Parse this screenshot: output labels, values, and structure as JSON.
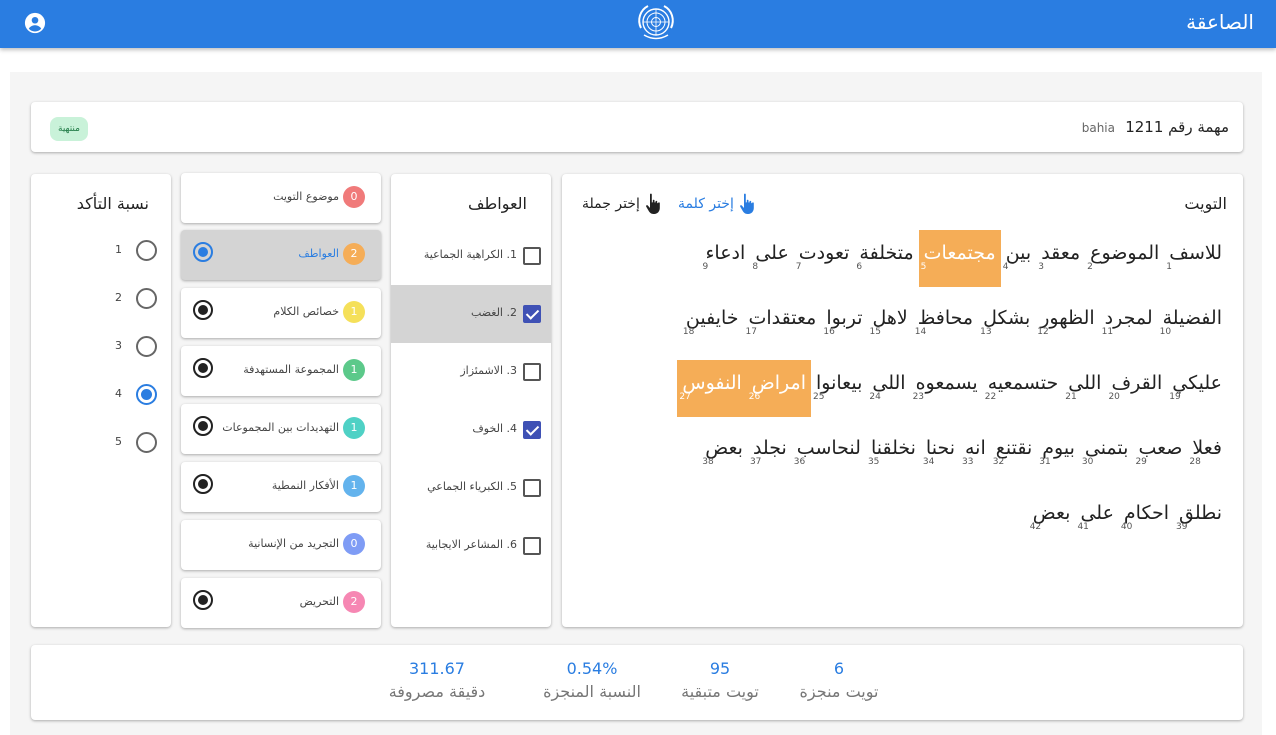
{
  "header": {
    "title": "الصاعقة",
    "account_icon": "account-circle-icon",
    "logo": "un-emblem-logo"
  },
  "task": {
    "label": "مهمة رقم",
    "number": "1211",
    "user": "bahia",
    "status": "منتهية"
  },
  "tweet": {
    "heading": "التويت",
    "select_word": "إختر كلمة",
    "select_sentence": "إختر جملة",
    "words": [
      {
        "text": "للاسف",
        "index": "1",
        "highlighted": false
      },
      {
        "text": "الموضوع",
        "index": "2",
        "highlighted": false
      },
      {
        "text": "معقد",
        "index": "3",
        "highlighted": false
      },
      {
        "text": "بين",
        "index": "4",
        "highlighted": false
      },
      {
        "text": "مجتمعات",
        "index": "5",
        "highlighted": true
      },
      {
        "text": "متخلفة",
        "index": "6",
        "highlighted": false
      },
      {
        "text": "تعودت",
        "index": "7",
        "highlighted": false
      },
      {
        "text": "على",
        "index": "8",
        "highlighted": false
      },
      {
        "text": "ادعاء",
        "index": "9",
        "highlighted": false
      },
      {
        "text": "الفضيلة",
        "index": "10",
        "highlighted": false
      },
      {
        "text": "لمجرد",
        "index": "11",
        "highlighted": false
      },
      {
        "text": "الظهور",
        "index": "12",
        "highlighted": false
      },
      {
        "text": "بشكل",
        "index": "13",
        "highlighted": false
      },
      {
        "text": "محافظ",
        "index": "14",
        "highlighted": false
      },
      {
        "text": "لاهل",
        "index": "15",
        "highlighted": false
      },
      {
        "text": "تربوا",
        "index": "16",
        "highlighted": false
      },
      {
        "text": "معتقدات",
        "index": "17",
        "highlighted": false
      },
      {
        "text": "خايفين",
        "index": "18",
        "highlighted": false
      },
      {
        "text": "عليكي",
        "index": "19",
        "highlighted": false
      },
      {
        "text": "القرف",
        "index": "20",
        "highlighted": false
      },
      {
        "text": "اللى",
        "index": "21",
        "highlighted": false
      },
      {
        "text": "حتسمعيه",
        "index": "22",
        "highlighted": false
      },
      {
        "text": "يسمعوه",
        "index": "23",
        "highlighted": false
      },
      {
        "text": "اللى",
        "index": "24",
        "highlighted": false
      },
      {
        "text": "بيعانوا",
        "index": "25",
        "highlighted": false
      },
      {
        "text": "امراض",
        "index": "26",
        "highlighted": true
      },
      {
        "text": "النفوس",
        "index": "27",
        "highlighted": true
      },
      {
        "text": "فعلا",
        "index": "28",
        "highlighted": false
      },
      {
        "text": "صعب",
        "index": "29",
        "highlighted": false
      },
      {
        "text": "بتمنى",
        "index": "30",
        "highlighted": false
      },
      {
        "text": "بيوم",
        "index": "31",
        "highlighted": false
      },
      {
        "text": "نقتنع",
        "index": "32",
        "highlighted": false
      },
      {
        "text": "انه",
        "index": "33",
        "highlighted": false
      },
      {
        "text": "نحنا",
        "index": "34",
        "highlighted": false
      },
      {
        "text": "نخلقنا",
        "index": "35",
        "highlighted": false
      },
      {
        "text": "لنحاسب",
        "index": "36",
        "highlighted": false
      },
      {
        "text": "نجلد",
        "index": "37",
        "highlighted": false
      },
      {
        "text": "بعض",
        "index": "38",
        "highlighted": false
      },
      {
        "text": "نطلق",
        "index": "39",
        "highlighted": false
      },
      {
        "text": "احكام",
        "index": "40",
        "highlighted": false
      },
      {
        "text": "على",
        "index": "41",
        "highlighted": false
      },
      {
        "text": "بعض",
        "index": "42",
        "highlighted": false
      }
    ]
  },
  "emotions": {
    "title": "العواطف",
    "items": [
      {
        "label": "1. الكراهية الجماعية",
        "checked": false,
        "selected": false
      },
      {
        "label": "2. الغضب",
        "checked": true,
        "selected": true
      },
      {
        "label": "3. الاشمئزاز",
        "checked": false,
        "selected": false
      },
      {
        "label": "4. الخوف",
        "checked": true,
        "selected": false
      },
      {
        "label": "5. الكبرياء الجماعي",
        "checked": false,
        "selected": false
      },
      {
        "label": "6. المشاعر الايجابية",
        "checked": false,
        "selected": false
      }
    ]
  },
  "categories": [
    {
      "label": "موضوع التويت",
      "count": "0",
      "color": "#f07a7a",
      "has_radio": false,
      "selected": false
    },
    {
      "label": "العواطف",
      "count": "2",
      "color": "#f5ad57",
      "has_radio": true,
      "selected": true
    },
    {
      "label": "خصائص الكلام",
      "count": "1",
      "color": "#f5e05a",
      "has_radio": true,
      "selected": false
    },
    {
      "label": "المجموعة المستهدفة",
      "count": "1",
      "color": "#5cc98a",
      "has_radio": true,
      "selected": false
    },
    {
      "label": "التهديدات بين المجموعات",
      "count": "1",
      "color": "#4fd1c5",
      "has_radio": true,
      "selected": false
    },
    {
      "label": "الأفكار النمطية",
      "count": "1",
      "color": "#63b3ed",
      "has_radio": true,
      "selected": false
    },
    {
      "label": "التجريد من الإنسانية",
      "count": "0",
      "color": "#7f9cf5",
      "has_radio": false,
      "selected": false
    },
    {
      "label": "التحريض",
      "count": "2",
      "color": "#f687b3",
      "has_radio": true,
      "selected": false
    }
  ],
  "confidence": {
    "title": "نسبة التأكد",
    "levels": [
      "1",
      "2",
      "3",
      "4",
      "5"
    ],
    "selected": "4"
  },
  "stats": [
    {
      "value": "6",
      "label": "تويت منجزة"
    },
    {
      "value": "95",
      "label": "تويت متبقية"
    },
    {
      "value": "0.54%",
      "label": "النسبة المنجزة"
    },
    {
      "value": "311.67",
      "label": "دقيقة مصروفة"
    }
  ],
  "colors": {
    "primary": "#2a7de1",
    "highlight": "#f5ad57",
    "checkbox": "#3f51b5",
    "status_badge": "#c9f2d9"
  }
}
